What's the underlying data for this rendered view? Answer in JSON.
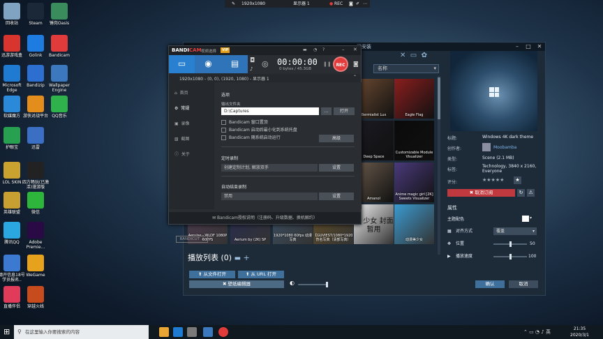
{
  "desktop_icons": [
    {
      "label": "回收站",
      "color": "#7fa3c0"
    },
    {
      "label": "Steam",
      "color": "#1b2838"
    },
    {
      "label": "锤岗Oasis",
      "color": "#3a8c5c"
    },
    {
      "label": "迅游游戏盒",
      "color": "#d8352e"
    },
    {
      "label": "Golink",
      "color": "#1e7be0"
    },
    {
      "label": "Bandicam",
      "color": "#e23b3b"
    },
    {
      "label": "Microsoft Edge",
      "color": "#1f7bd2"
    },
    {
      "label": "Bandizip",
      "color": "#2c6fd1"
    },
    {
      "label": "Wallpaper Engine",
      "color": "#3b78bd"
    },
    {
      "label": "软媒魔方",
      "color": "#2b89d9"
    },
    {
      "label": "游侠对战平台",
      "color": "#e38d1d"
    },
    {
      "label": "QQ音乐",
      "color": "#2fb24c"
    },
    {
      "label": "护眼宝",
      "color": "#27a050"
    },
    {
      "label": "迅雷",
      "color": "#3a6fc4"
    },
    {
      "label": "LOL SKIN",
      "color": "#c9a230"
    },
    {
      "label": "四方畅玩(已激活)漫游版",
      "color": "#222"
    },
    {
      "label": "英雄联盟",
      "color": "#c8a032"
    },
    {
      "label": "微信",
      "color": "#2eb53b"
    },
    {
      "label": "腾讯QQ",
      "color": "#2aa6e0"
    },
    {
      "label": "Adobe Premie...",
      "color": "#2a0a44"
    },
    {
      "label": "德开信息18号学员报名..",
      "color": "#3c7ad1"
    },
    {
      "label": "WeGame",
      "color": "#e6a21d"
    },
    {
      "label": "直播伴侣",
      "color": "#e03c5a"
    },
    {
      "label": "穿越火线",
      "color": "#c64b1d"
    }
  ],
  "recbar": {
    "resolution": "1920x1080",
    "monitor": "显示器 1",
    "rec": "REC"
  },
  "wallpaper_engine": {
    "title": "已安装",
    "sort": "名称",
    "tiles": [
      {
        "label": "Bermialist Lux",
        "color": "#6c4a32"
      },
      {
        "label": "Eagle Flag",
        "color": "#8b1e1e"
      },
      {
        "label": "Deep Space",
        "color": "#1a1a22"
      },
      {
        "label": "Customizable Module Visualizer",
        "color": "#0a0a0a"
      },
      {
        "label": "Amanol",
        "color": "#6a5a4c"
      },
      {
        "label": "Anime magic girl [2K] Sweets Visualizer",
        "color": "#4a3a7a"
      },
      {
        "label": "Aerulse - WLDF 1080P 60FPS",
        "color": "#4a3a4a"
      },
      {
        "label": "Aerium by (2K) SP",
        "color": "#2a2e4a"
      },
      {
        "label": "1920*1080 60fps 动漫写真",
        "color": "#3a4a5a"
      },
      {
        "label": "【GUVIEST/1080*1920】 伤名写真（清部写真）",
        "color": "#5a4a2a"
      },
      {
        "label": "AI 少女 封面暂用",
        "color": "#eeeeee"
      },
      {
        "label": "动漫美少女",
        "color": "#3a9ad0"
      }
    ],
    "playlist": "播放列表 (0)",
    "btn_open_file": "从文件打开",
    "btn_open_url": "从 URL 打开",
    "btn_editor": "壁纸编辑器",
    "btn_ok": "确认",
    "btn_cancel": "取消",
    "details": {
      "title_label": "标题:",
      "title": "Windows 4K dark theme",
      "author_label": "创作者:",
      "author": "Moobamba",
      "type_label": "类型:",
      "type": "Scene (2.1 MB)",
      "tags_label": "标签:",
      "tags": "Technology, 3840 x 2160, Everyone",
      "rating_label": "评分:",
      "stars": "★★★★★",
      "unsubscribe": "取消订阅"
    },
    "props": {
      "header": "属性",
      "color_label": "主题配色",
      "align_label": "对齐方式",
      "align_value": "覆盖",
      "position_label": "位置",
      "position_value": "50",
      "position_level": 0.5,
      "speed_label": "播放速度",
      "speed_value": "100",
      "speed_level": 0.5
    }
  },
  "bandicam": {
    "brand_a": "BANDI",
    "brand_b": "CAM",
    "mode_text": "视频选择",
    "vip": "VIP",
    "timer": "00:00:00",
    "size": "0 bytes / 45.3GB",
    "rec": "REC",
    "info": "1920x1080 - (0, 0), (1920, 1080) - 显示器 1",
    "nav": [
      "首页",
      "常规",
      "录像",
      "截图",
      "关于"
    ],
    "section_options": "选项",
    "output_label": "输出文件夹",
    "output_path": "D:\\Captures",
    "btn_dots": "...",
    "btn_open": "打开",
    "checks": [
      "Bandicam 窗口置顶",
      "Bandicam 启动后最小化到系统托盘",
      "Bandicam 随系统启动运行"
    ],
    "btn_advanced": "高级",
    "section_timer": "定时录制",
    "timer_field": "创建定制计划, 解放双手",
    "btn_settings1": "设置",
    "section_auto": "自动结束录制",
    "auto_field": "禁用",
    "btn_settings2": "设置",
    "bandicut": "BANDICUT ↗",
    "bottom": "Bandicam授权说明（注册码、升级数据、换机解约）"
  },
  "taskbar": {
    "search_placeholder": "在这里输入你要搜索的内容",
    "time": "21:35",
    "date": "2020/3/1"
  }
}
